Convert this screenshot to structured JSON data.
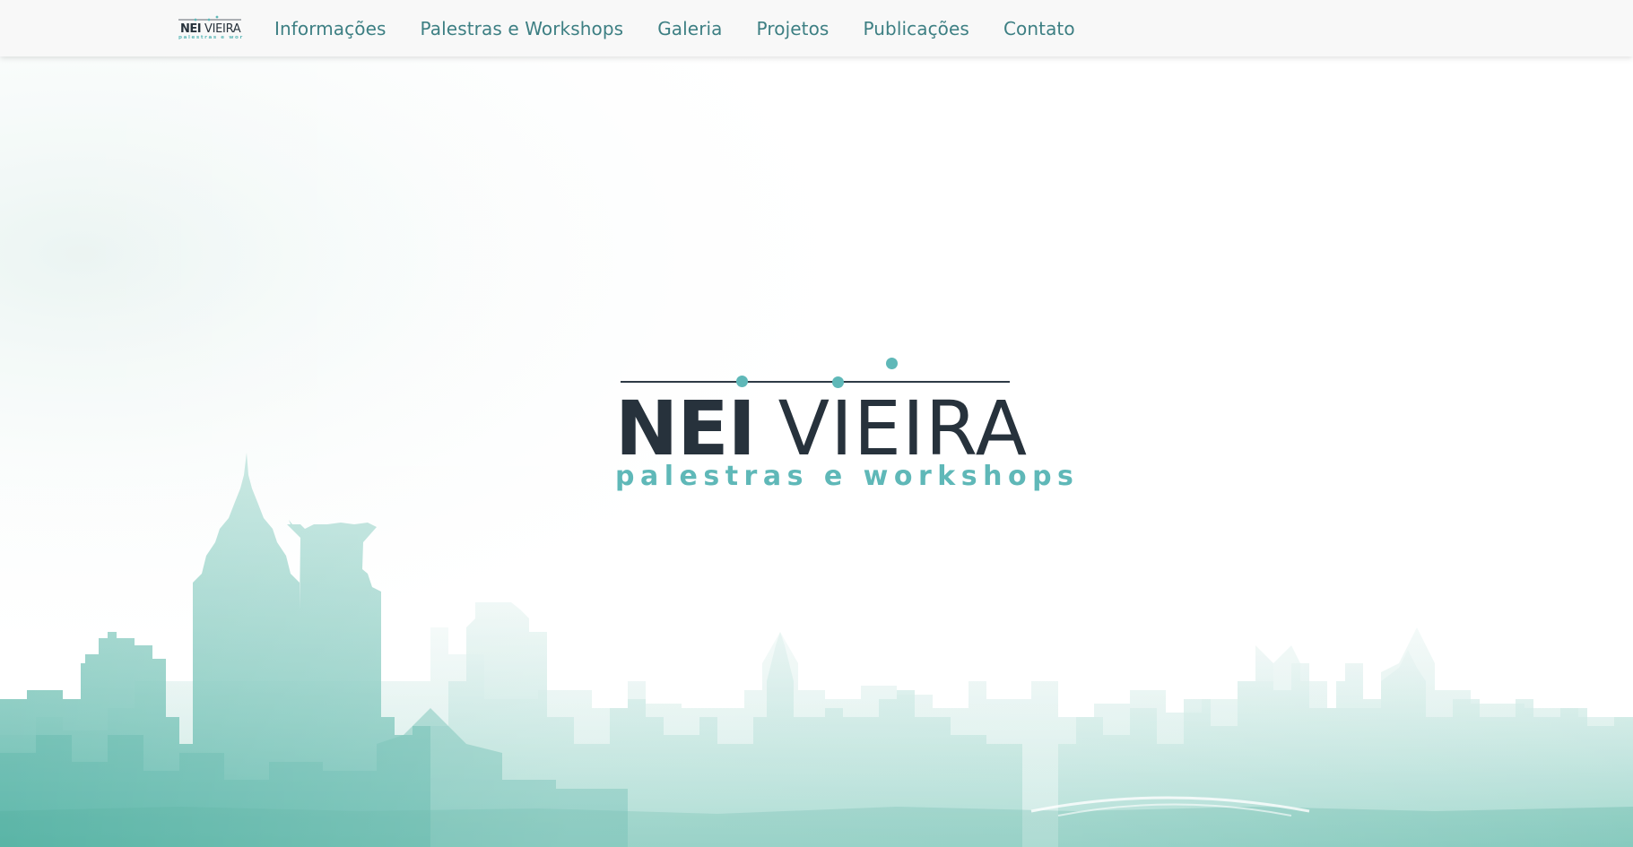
{
  "navbar": {
    "brand": {
      "name": "NEI VIEIRA",
      "tagline": "palestras e workshops"
    },
    "links": [
      "Informações",
      "Palestras e Workshops",
      "Galeria",
      "Projetos",
      "Publicações",
      "Contato"
    ]
  },
  "hero": {
    "logo": {
      "first_name": "NEI",
      "last_name": "VIEIRA",
      "tagline": "palestras e workshops"
    }
  },
  "colors": {
    "nav_background": "#f8f8f8",
    "nav_link": "#3d7f83",
    "logo_dark": "#27323c",
    "accent_teal": "#5fb8b8",
    "skyline_teal": "#7dc9bd"
  }
}
